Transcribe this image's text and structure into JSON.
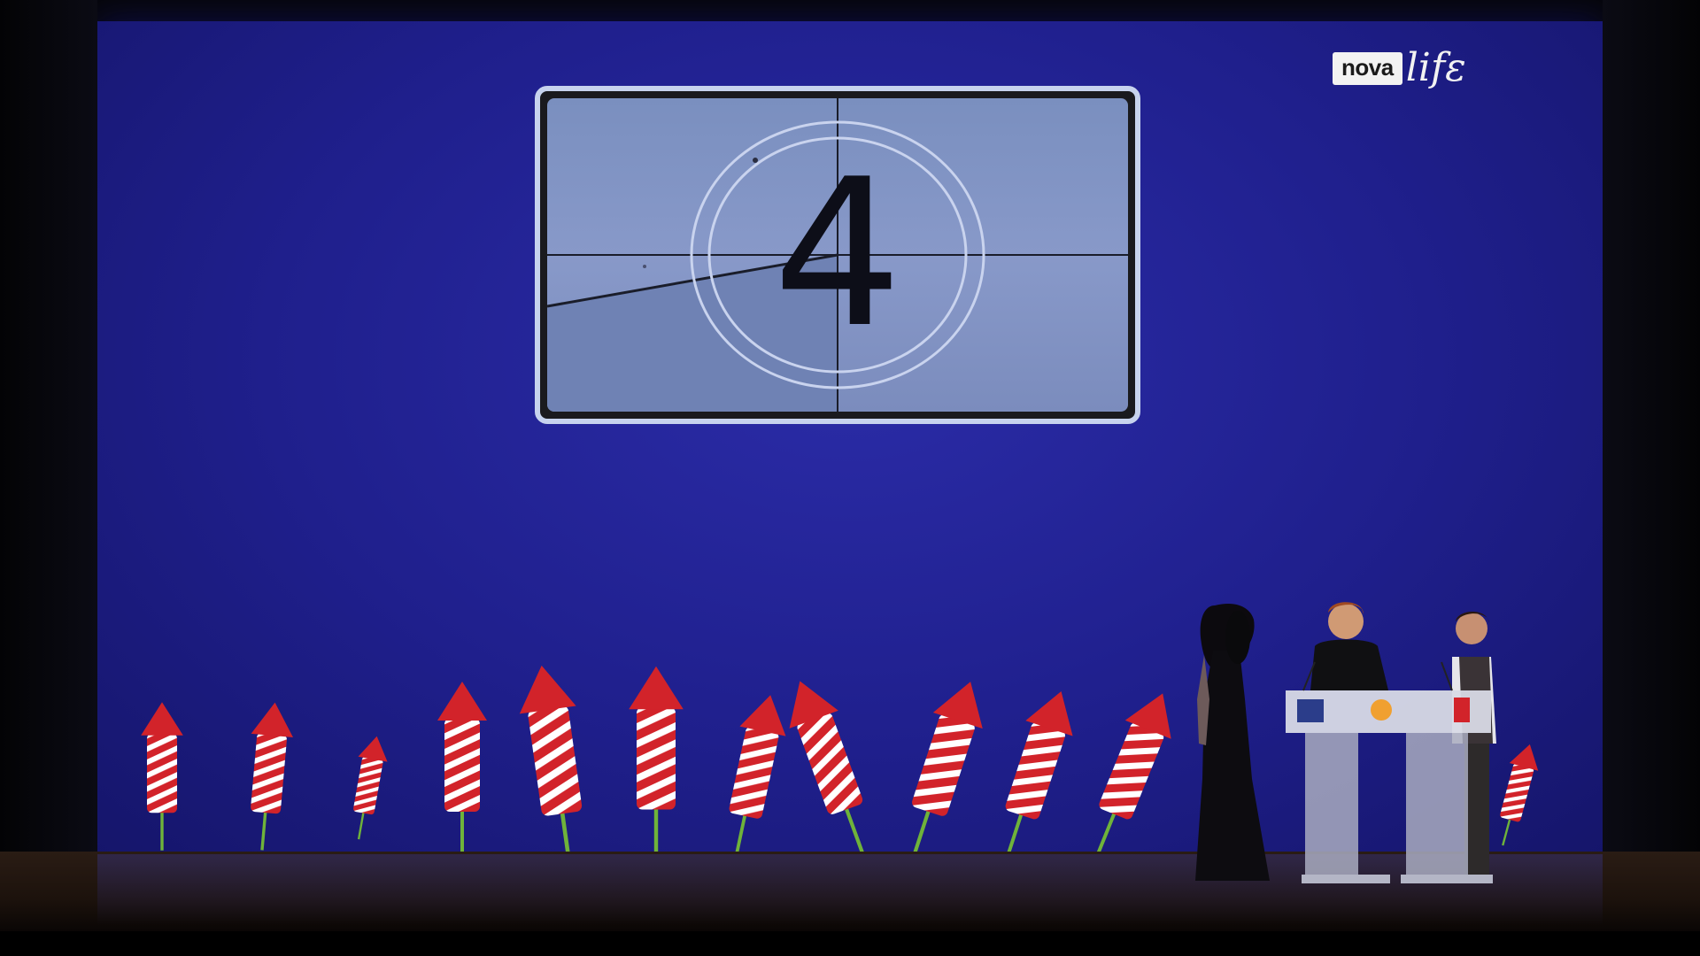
{
  "broadcast": {
    "logo_box_text": "nova",
    "logo_script_text": "lifε"
  },
  "screen": {
    "countdown_number": "4"
  },
  "colors": {
    "backdrop": "#2426a0",
    "rocket_red": "#d2232a",
    "rocket_white": "#ffffff",
    "stick_green": "#6fb33a"
  }
}
